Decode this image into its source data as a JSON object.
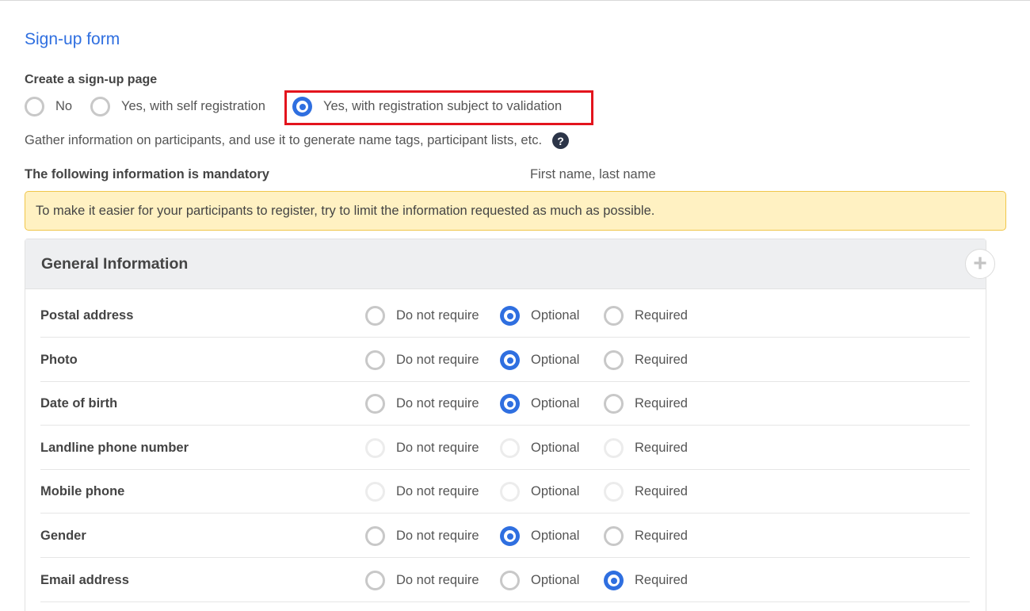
{
  "section_title": "Sign-up form",
  "create_page": {
    "label": "Create a sign-up page",
    "options": [
      "No",
      "Yes, with self registration",
      "Yes, with registration subject to validation"
    ],
    "selected": 2
  },
  "gather_text": "Gather information on participants, and use it to generate name tags, participant lists, etc.",
  "help_icon_glyph": "?",
  "mandatory": {
    "label": "The following information is mandatory",
    "value": "First name, last name"
  },
  "notice": "To make it easier for your participants to register, try to limit the information requested as much as possible.",
  "panel": {
    "title": "General Information",
    "add_glyph": "+",
    "choice_labels": [
      "Do not require",
      "Optional",
      "Required"
    ],
    "rows": [
      {
        "label": "Postal address",
        "selected": 1,
        "disabled": false
      },
      {
        "label": "Photo",
        "selected": 1,
        "disabled": false
      },
      {
        "label": "Date of birth",
        "selected": 1,
        "disabled": false
      },
      {
        "label": "Landline phone number",
        "selected": null,
        "disabled": true
      },
      {
        "label": "Mobile phone",
        "selected": null,
        "disabled": true
      },
      {
        "label": "Gender",
        "selected": 1,
        "disabled": false
      },
      {
        "label": "Email address",
        "selected": 2,
        "disabled": false
      }
    ]
  },
  "colors": {
    "accent": "#2f6fe0",
    "highlight_border": "#e3141d",
    "notice_bg": "#fff1c2",
    "notice_border": "#f0c64a"
  }
}
